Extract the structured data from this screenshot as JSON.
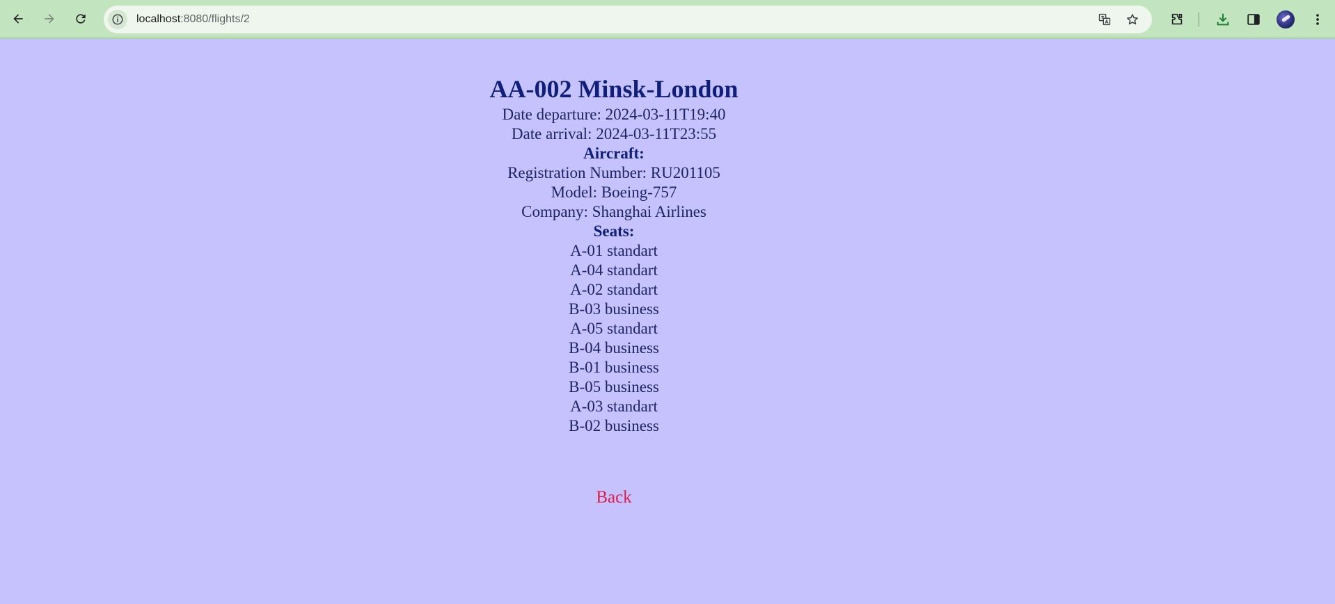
{
  "browser": {
    "url_host": "localhost",
    "url_path": ":8080/flights/2"
  },
  "flight": {
    "title": "AA-002 Minsk-London",
    "date_departure": "Date departure: 2024-03-11T19:40",
    "date_arrival": "Date arrival: 2024-03-11T23:55"
  },
  "aircraft": {
    "heading": "Aircraft:",
    "registration_number": "Registration Number: RU201105",
    "model": "Model: Boeing-757",
    "company": "Company: Shanghai Airlines"
  },
  "seats": {
    "heading": "Seats:",
    "items": [
      "A-01 standart",
      "A-04 standart",
      "A-02 standart",
      "B-03 business",
      "A-05 standart",
      "B-04 business",
      "B-01 business",
      "B-05 business",
      "A-03 standart",
      "B-02 business"
    ]
  },
  "back_link": "Back",
  "colors": {
    "page_background": "#c5c2fd",
    "title": "#101f78",
    "text": "#1f2466",
    "link": "#dc1f4a",
    "browser_bar": "#c2e5bf"
  }
}
